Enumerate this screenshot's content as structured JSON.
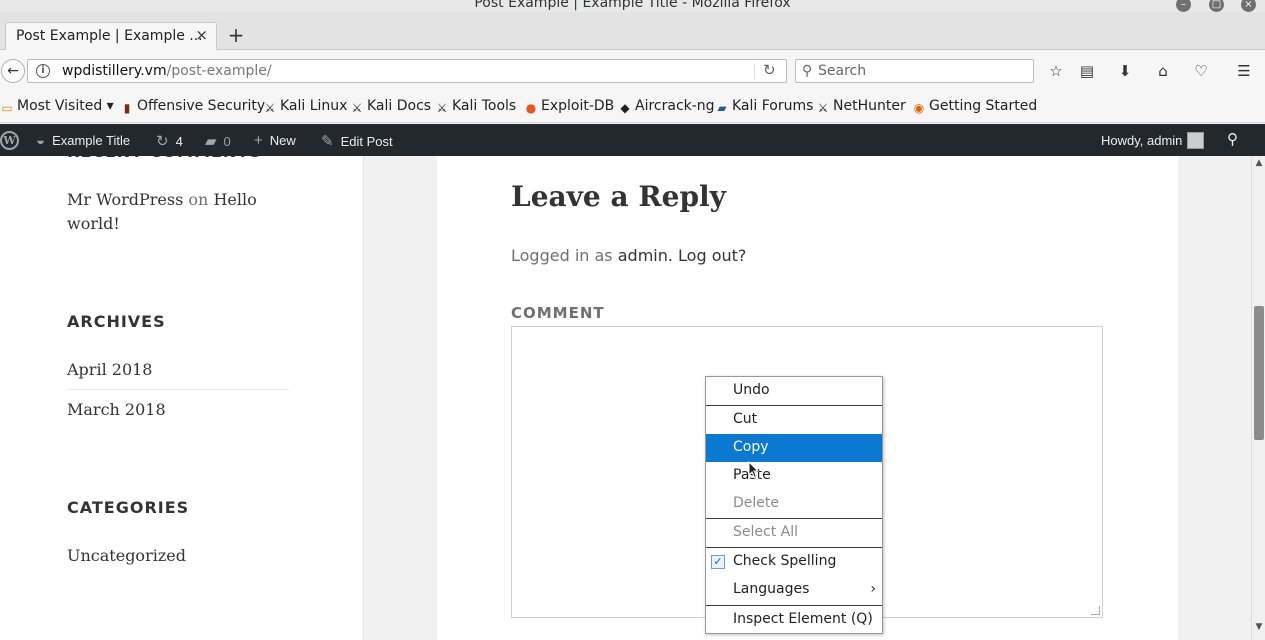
{
  "window": {
    "title": "Post Example | Example Title - Mozilla Firefox"
  },
  "tabs": [
    {
      "label": "Post Example | Example ..."
    }
  ],
  "nav": {
    "url_host": "wpdistillery.vm",
    "url_path": "/post-example/",
    "search_placeholder": "Search"
  },
  "bookmarks": [
    {
      "label": "Most Visited",
      "icon": "folder-icon"
    },
    {
      "label": "Offensive Security",
      "icon": "offsec-icon"
    },
    {
      "label": "Kali Linux",
      "icon": "kali-icon"
    },
    {
      "label": "Kali Docs",
      "icon": "kali-icon"
    },
    {
      "label": "Kali Tools",
      "icon": "kali-icon"
    },
    {
      "label": "Exploit-DB",
      "icon": "exploitdb-icon"
    },
    {
      "label": "Aircrack-ng",
      "icon": "aircrack-icon"
    },
    {
      "label": "Kali Forums",
      "icon": "kali-forums-icon"
    },
    {
      "label": "NetHunter",
      "icon": "kali-icon"
    },
    {
      "label": "Getting Started",
      "icon": "firefox-icon"
    }
  ],
  "adminbar": {
    "site_name": "Example Title",
    "updates_count": "4",
    "comments_count": "0",
    "new_label": "New",
    "edit_post_label": "Edit Post",
    "howdy": "Howdy, admin"
  },
  "sidebar": {
    "recent_comment": {
      "author": "Mr WordPress",
      "on": "on",
      "post": "Hello world!"
    },
    "archives_title": "ARCHIVES",
    "archives": [
      "April 2018",
      "March 2018"
    ],
    "categories_title": "CATEGORIES",
    "categories": [
      "Uncategorized"
    ]
  },
  "main": {
    "reply_title": "Leave a Reply",
    "logged_in_prefix": "Logged in as",
    "logged_in_user": "admin.",
    "logout_link": "Log out?",
    "comment_label": "COMMENT"
  },
  "context_menu": {
    "items": [
      {
        "label": "Undo",
        "state": "normal"
      },
      {
        "label": "Cut",
        "state": "normal"
      },
      {
        "label": "Copy",
        "state": "selected"
      },
      {
        "label": "Paste",
        "state": "normal"
      },
      {
        "label": "Delete",
        "state": "disabled"
      },
      {
        "label": "Select All",
        "state": "disabled"
      },
      {
        "label": "Check Spelling",
        "state": "checked"
      },
      {
        "label": "Languages",
        "state": "submenu"
      },
      {
        "label": "Inspect Element (Q)",
        "state": "normal"
      }
    ]
  },
  "colors": {
    "selection": "#0b78d1",
    "adminbar": "#23282d"
  }
}
